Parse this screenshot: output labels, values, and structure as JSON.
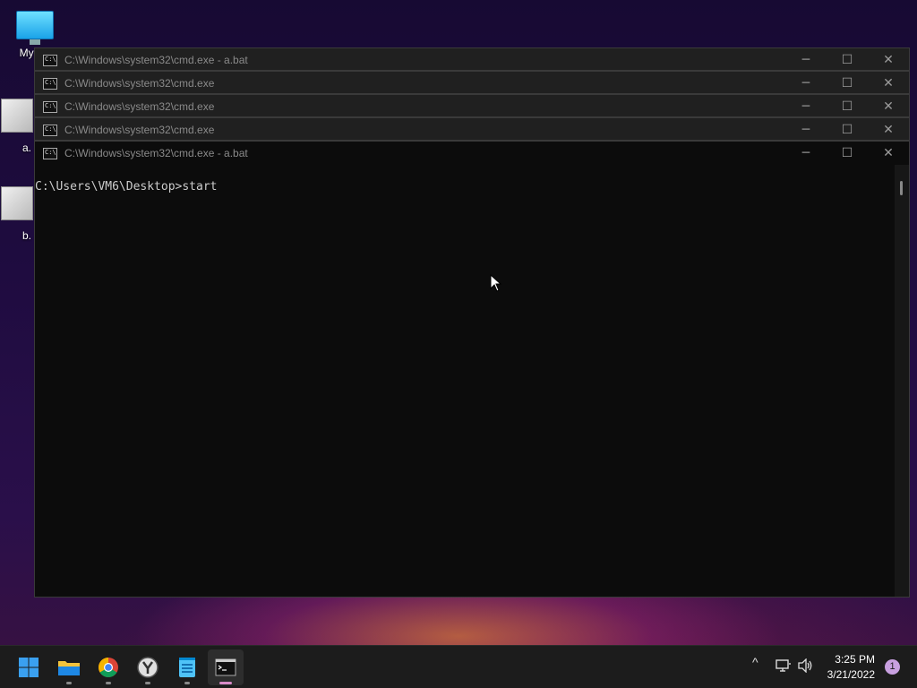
{
  "desktop": {
    "icons": [
      {
        "label": "My Co",
        "icon": "monitor-icon"
      },
      {
        "label": "a.",
        "icon": "file-icon"
      },
      {
        "label": "b.",
        "icon": "file-icon"
      }
    ]
  },
  "windows": [
    {
      "title": "C:\\Windows\\system32\\cmd.exe - a.bat"
    },
    {
      "title": "C:\\Windows\\system32\\cmd.exe"
    },
    {
      "title": "C:\\Windows\\system32\\cmd.exe"
    },
    {
      "title": "C:\\Windows\\system32\\cmd.exe"
    },
    {
      "title": "C:\\Windows\\system32\\cmd.exe - a.bat"
    }
  ],
  "window_controls": {
    "minimize": "─",
    "maximize": "☐",
    "close": "✕"
  },
  "console": {
    "line": "C:\\Users\\VM6\\Desktop>start"
  },
  "taskbar": {
    "apps": [
      {
        "name": "start",
        "icon": "windows-logo-icon",
        "active": false
      },
      {
        "name": "file-explorer",
        "icon": "folder-icon",
        "active": false
      },
      {
        "name": "chrome",
        "icon": "chrome-icon",
        "active": false
      },
      {
        "name": "app-y",
        "icon": "y-app-icon",
        "active": false
      },
      {
        "name": "notepad",
        "icon": "notepad-icon",
        "active": false
      },
      {
        "name": "cmd",
        "icon": "terminal-icon",
        "active": true
      }
    ],
    "tray": {
      "chevron": "^",
      "time": "3:25 PM",
      "date": "3/21/2022",
      "notifications": "1"
    }
  },
  "colors": {
    "accent": "#d88ac8",
    "console_bg": "#0c0c0c",
    "titlebar": "#202020"
  }
}
